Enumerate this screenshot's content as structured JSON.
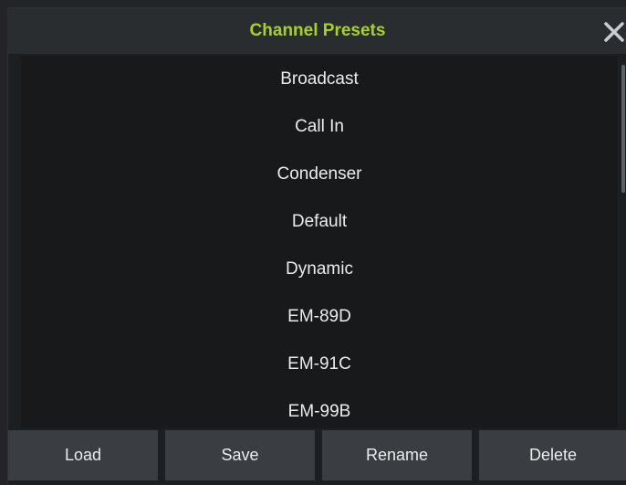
{
  "dialog": {
    "title": "Channel Presets",
    "close_icon": "close-icon"
  },
  "presets": [
    {
      "label": "Broadcast"
    },
    {
      "label": "Call In"
    },
    {
      "label": "Condenser"
    },
    {
      "label": "Default"
    },
    {
      "label": "Dynamic"
    },
    {
      "label": "EM-89D"
    },
    {
      "label": "EM-91C"
    },
    {
      "label": "EM-99B"
    }
  ],
  "buttons": {
    "load_label": "Load",
    "save_label": "Save",
    "rename_label": "Rename",
    "delete_label": "Delete"
  },
  "colors": {
    "title": "#a6d31f",
    "background": "#1c1f22",
    "list_background": "#17191b",
    "button_background": "#3a3e43",
    "text": "#ececec"
  }
}
